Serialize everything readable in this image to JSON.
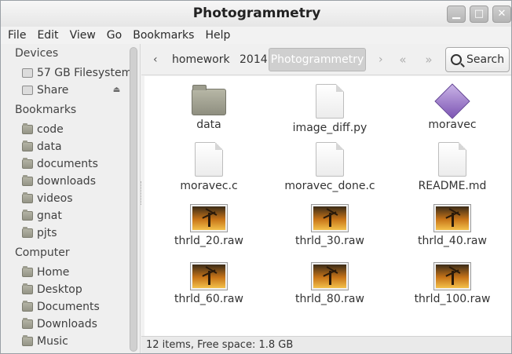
{
  "window": {
    "title": "Photogrammetry",
    "controls": {
      "minimize": "▁",
      "maximize": "□",
      "close": "✕"
    }
  },
  "menubar": [
    "File",
    "Edit",
    "View",
    "Go",
    "Bookmarks",
    "Help"
  ],
  "sidebar": {
    "devices_header": "Devices",
    "devices": [
      {
        "label": "57 GB Filesystem",
        "icon": "drive-icon"
      },
      {
        "label": "Share",
        "icon": "drive-icon",
        "eject": "⏏"
      }
    ],
    "bookmarks_header": "Bookmarks",
    "bookmarks": [
      "code",
      "data",
      "documents",
      "downloads",
      "videos",
      "gnat",
      "pjts"
    ],
    "computer_header": "Computer",
    "computer": [
      "Home",
      "Desktop",
      "Documents",
      "Downloads",
      "Music"
    ]
  },
  "toolbar": {
    "back_arrow": "‹",
    "forward_arrow": "›",
    "breadcrumbs": [
      "homework",
      "2014"
    ],
    "active_crumb": "Photogrammetry",
    "search_label": "Search"
  },
  "files": [
    {
      "name": "data",
      "type": "folder"
    },
    {
      "name": "image_diff.py",
      "type": "doc"
    },
    {
      "name": "moravec",
      "type": "executable"
    },
    {
      "name": "moravec.c",
      "type": "doc"
    },
    {
      "name": "moravec_done.c",
      "type": "doc"
    },
    {
      "name": "README.md",
      "type": "doc"
    },
    {
      "name": "thrld_20.raw",
      "type": "image"
    },
    {
      "name": "thrld_30.raw",
      "type": "image"
    },
    {
      "name": "thrld_40.raw",
      "type": "image"
    },
    {
      "name": "thrld_60.raw",
      "type": "image"
    },
    {
      "name": "thrld_80.raw",
      "type": "image"
    },
    {
      "name": "thrld_100.raw",
      "type": "image"
    }
  ],
  "status": "12 items, Free space: 1.8 GB"
}
